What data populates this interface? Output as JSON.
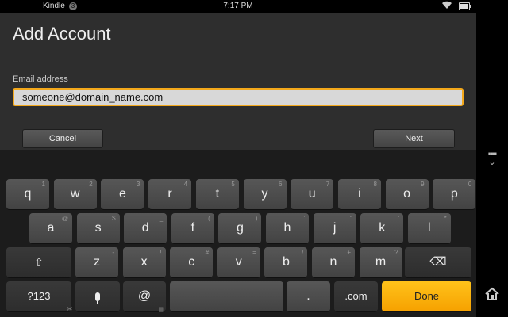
{
  "status": {
    "app_name": "Kindle",
    "notification_count": "3",
    "time": "7:17 PM",
    "battery_level": 0.9
  },
  "page": {
    "title": "Add Account"
  },
  "form": {
    "email_label": "Email address",
    "email_value": "someone@domain_name.com"
  },
  "buttons": {
    "cancel": "Cancel",
    "next": "Next"
  },
  "keyboard": {
    "row1": [
      {
        "k": "q",
        "s": "1"
      },
      {
        "k": "w",
        "s": "2"
      },
      {
        "k": "e",
        "s": "3"
      },
      {
        "k": "r",
        "s": "4"
      },
      {
        "k": "t",
        "s": "5"
      },
      {
        "k": "y",
        "s": "6"
      },
      {
        "k": "u",
        "s": "7"
      },
      {
        "k": "i",
        "s": "8"
      },
      {
        "k": "o",
        "s": "9"
      },
      {
        "k": "p",
        "s": "0"
      }
    ],
    "row2": [
      {
        "k": "a",
        "s": "@"
      },
      {
        "k": "s",
        "s": "$"
      },
      {
        "k": "d",
        "s": "_"
      },
      {
        "k": "f",
        "s": "("
      },
      {
        "k": "g",
        "s": ")"
      },
      {
        "k": "h",
        "s": "'"
      },
      {
        "k": "j",
        "s": "\""
      },
      {
        "k": "k",
        "s": "'"
      },
      {
        "k": "l",
        "s": "*"
      }
    ],
    "row3": [
      {
        "k": "z",
        "s": "-"
      },
      {
        "k": "x",
        "s": "!"
      },
      {
        "k": "c",
        "s": "#"
      },
      {
        "k": "v",
        "s": "="
      },
      {
        "k": "b",
        "s": "/"
      },
      {
        "k": "n",
        "s": "+"
      },
      {
        "k": "m",
        "s": "?"
      }
    ],
    "shift_glyph": "⇧",
    "backspace_glyph": "⌫",
    "symbols_label": "?123",
    "scissors_glyph": "✂",
    "at_label": "@",
    "grid_glyph": "▦",
    "period_label": ".",
    "dotcom_label": ".com",
    "done_label": "Done",
    "accent_color": "#f6a100"
  },
  "side": {
    "keyboard_hide_icon": "keyboard-hide-icon",
    "home_icon": "home-icon"
  }
}
